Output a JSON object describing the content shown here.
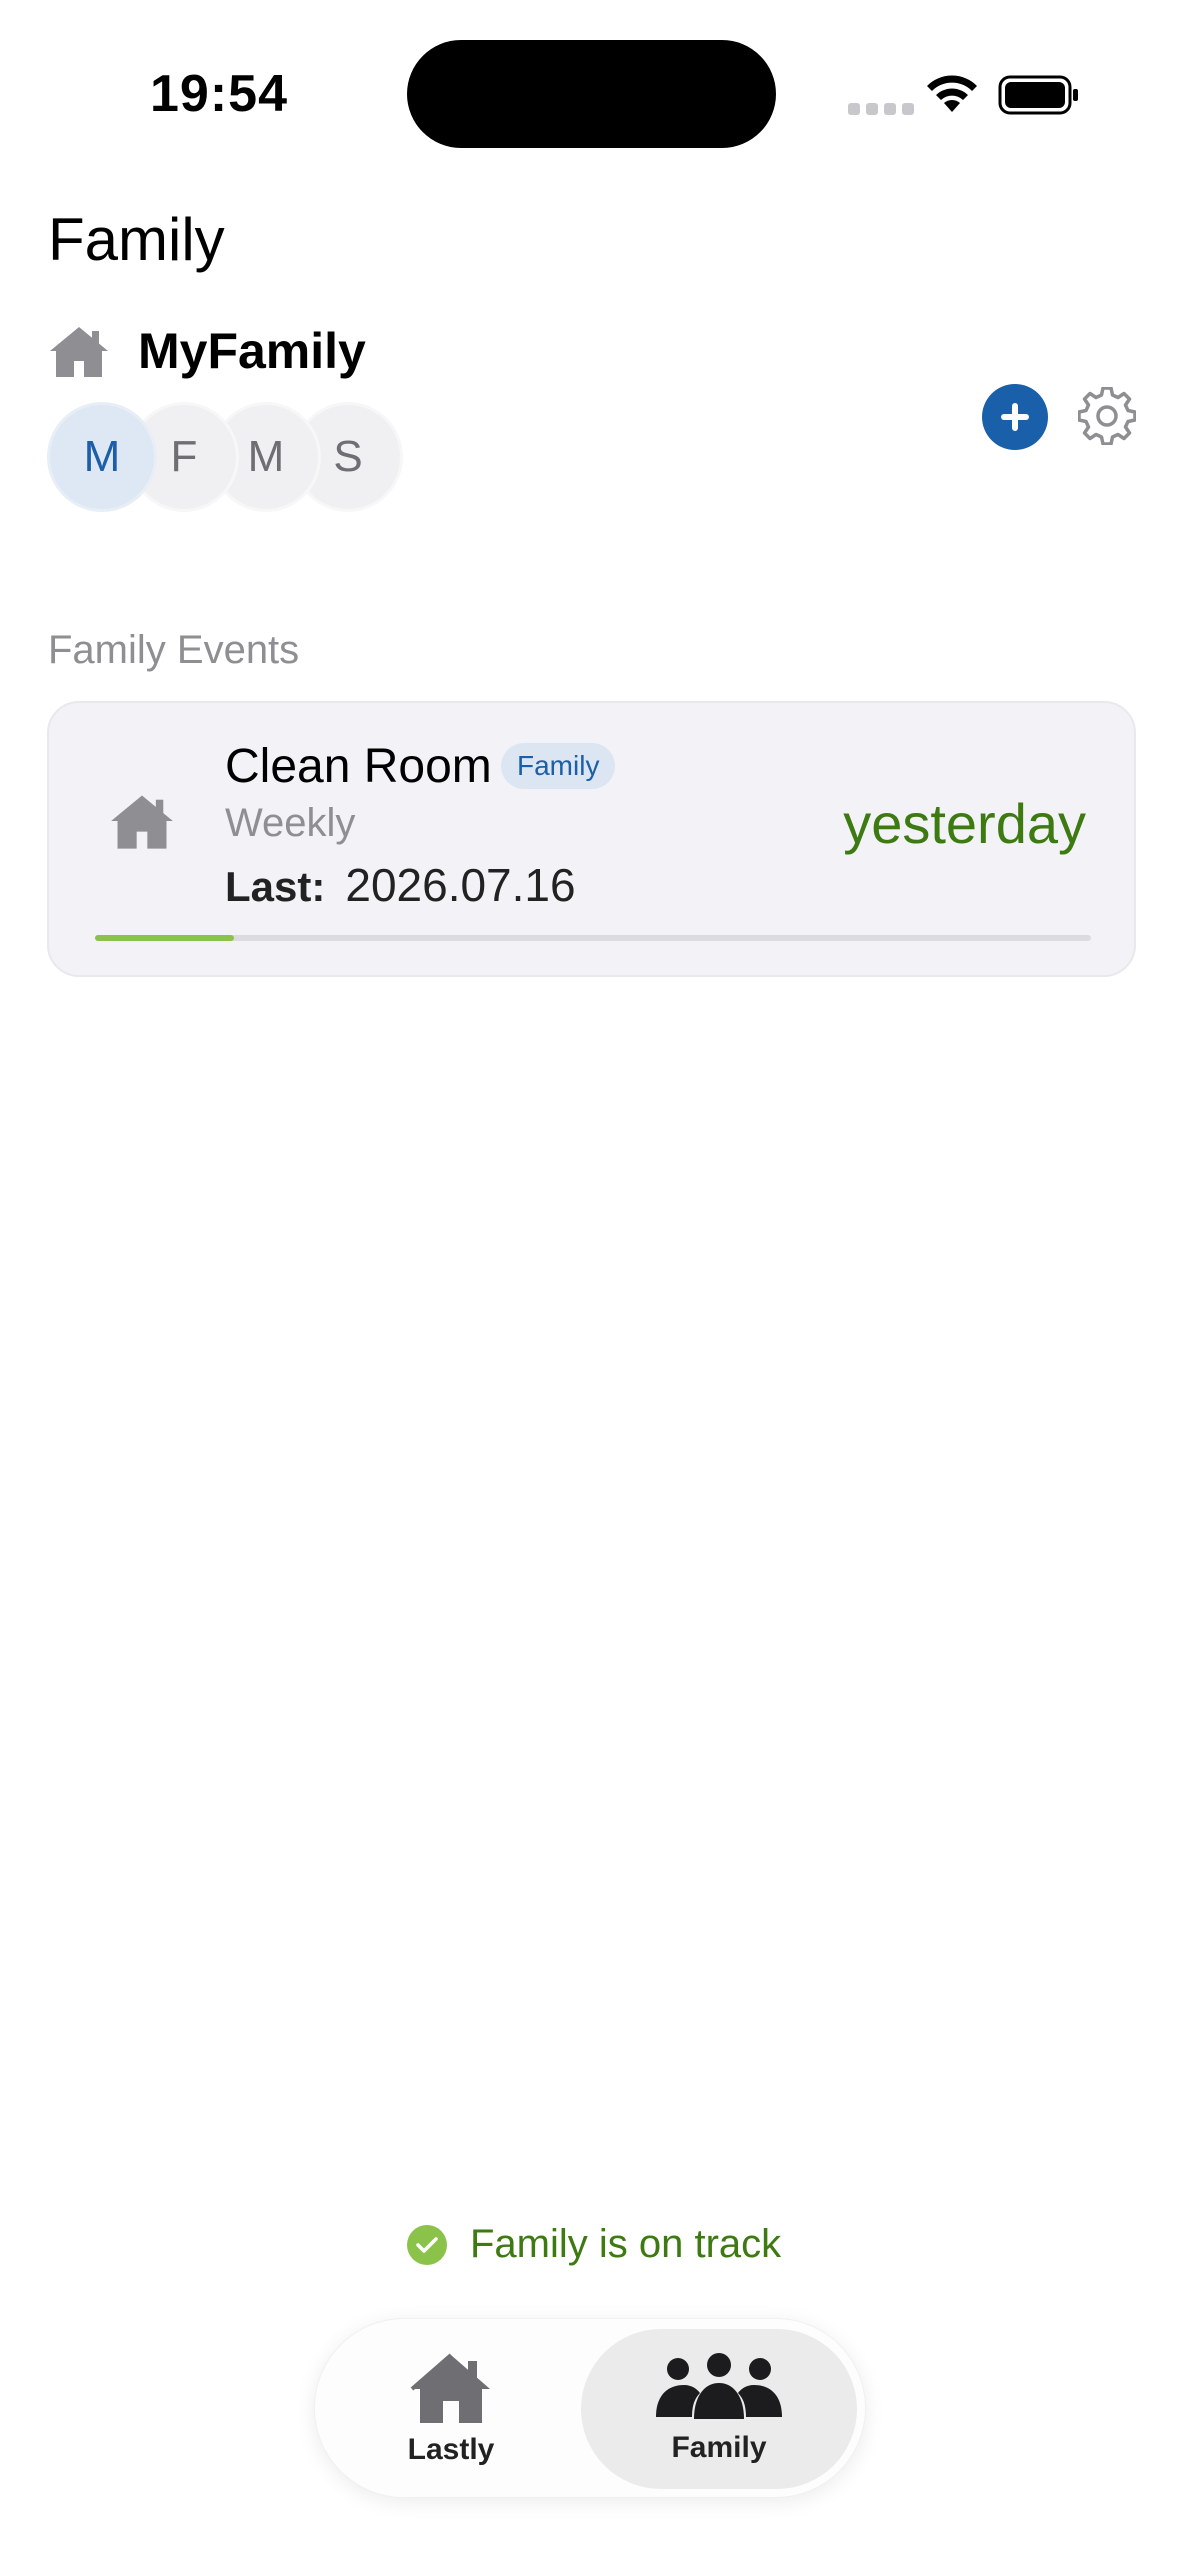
{
  "status_bar": {
    "time": "19:54"
  },
  "header": {
    "title": "Family"
  },
  "family": {
    "name": "MyFamily",
    "members": [
      "M",
      "F",
      "M",
      "S"
    ]
  },
  "section": {
    "title": "Family Events"
  },
  "events": [
    {
      "name": "Clean Room",
      "tag": "Family",
      "frequency": "Weekly",
      "last_label": "Last:",
      "last_date": "2026.07.16",
      "relative": "yesterday",
      "progress": 0.14
    }
  ],
  "track_status": "Family is on track",
  "tabs": [
    {
      "label": "Lastly",
      "icon": "home-icon",
      "selected": false
    },
    {
      "label": "Family",
      "icon": "people-icon",
      "selected": true
    }
  ],
  "colors": {
    "accent": "#1a5faa",
    "success": "#3e7a12",
    "progress": "#8bc34a"
  }
}
